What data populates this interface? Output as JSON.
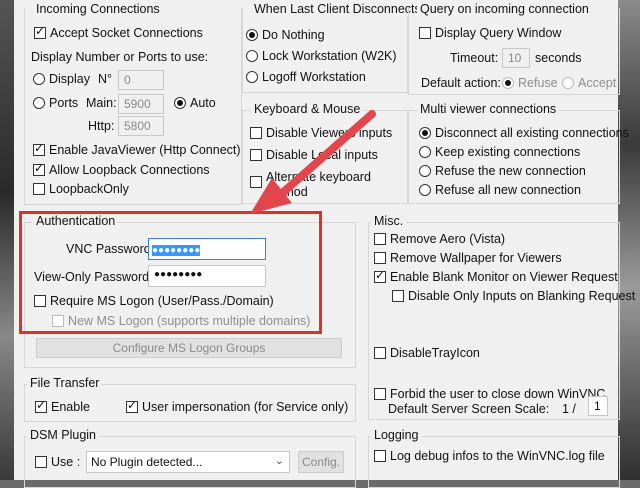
{
  "incoming": {
    "title": "Incoming Connections",
    "accept_socket": "Accept Socket Connections",
    "display_ports_label": "Display Number or Ports to use:",
    "display": "Display",
    "n_label": "N°",
    "n_value": "0",
    "ports": "Ports",
    "main_label": "Main:",
    "main_value": "5900",
    "auto": "Auto",
    "http_label": "Http:",
    "http_value": "5800",
    "enable_java": "Enable JavaViewer (Http Connect)",
    "allow_loopback": "Allow Loopback Connections",
    "loopback_only": "LoopbackOnly"
  },
  "disconnect": {
    "title": "When Last Client Disconnects",
    "do_nothing": "Do Nothing",
    "lock": "Lock Workstation (W2K)",
    "logoff": "Logoff Workstation"
  },
  "query": {
    "title": "Query on incoming connection",
    "display_query": "Display Query Window",
    "timeout_label": "Timeout:",
    "timeout_value": "10",
    "seconds": "seconds",
    "default_action_label": "Default action:",
    "refuse": "Refuse",
    "accept": "Accept"
  },
  "keyboard": {
    "title": "Keyboard & Mouse",
    "disable_viewers_inputs": "Disable Viewers inputs",
    "disable_local_inputs": "Disable Local inputs",
    "alternate_keyboard_1": "Alternate keyboard",
    "alternate_keyboard_2": "method"
  },
  "multi": {
    "title": "Multi viewer connections",
    "disconnect_all": "Disconnect all existing connections",
    "keep_existing": "Keep existing connections",
    "refuse_new": "Refuse the new connection",
    "refuse_all": "Refuse all new connection"
  },
  "auth": {
    "title": "Authentication",
    "vnc_password_label": "VNC Password:",
    "vnc_password_value": "●●●●●●●●",
    "view_only_label": "View-Only Password:",
    "view_only_value": "●●●●●●●●",
    "require_ms_logon": "Require MS Logon",
    "require_ms_logon_hint": "(User/Pass./Domain)",
    "new_ms_logon": "New MS Logon (supports multiple domains)",
    "configure_groups": "Configure MS Logon Groups"
  },
  "misc": {
    "title": "Misc.",
    "remove_aero": "Remove Aero (Vista)",
    "remove_wallpaper": "Remove Wallpaper for Viewers",
    "enable_blank": "Enable Blank Monitor on Viewer Request",
    "disable_only_inputs": "Disable Only Inputs on Blanking Request",
    "disable_tray": "DisableTrayIcon",
    "forbid_close": "Forbid the user to close down WinVNC",
    "scale_label": "Default Server Screen Scale:",
    "scale_prefix": "1 /",
    "scale_value": "1"
  },
  "file_transfer": {
    "title": "File Transfer",
    "enable": "Enable",
    "user_impersonation": "User impersonation (for Service only)"
  },
  "dsm": {
    "title": "DSM Plugin",
    "use": "Use :",
    "plugin_value": "No Plugin detected...",
    "config": "Config."
  },
  "logging": {
    "title": "Logging",
    "log_debug": "Log debug infos to the WinVNC.log file"
  },
  "colors": {
    "highlight_box": "#d9342b",
    "arrow": "#e2464c",
    "selection": "#3399ff"
  }
}
